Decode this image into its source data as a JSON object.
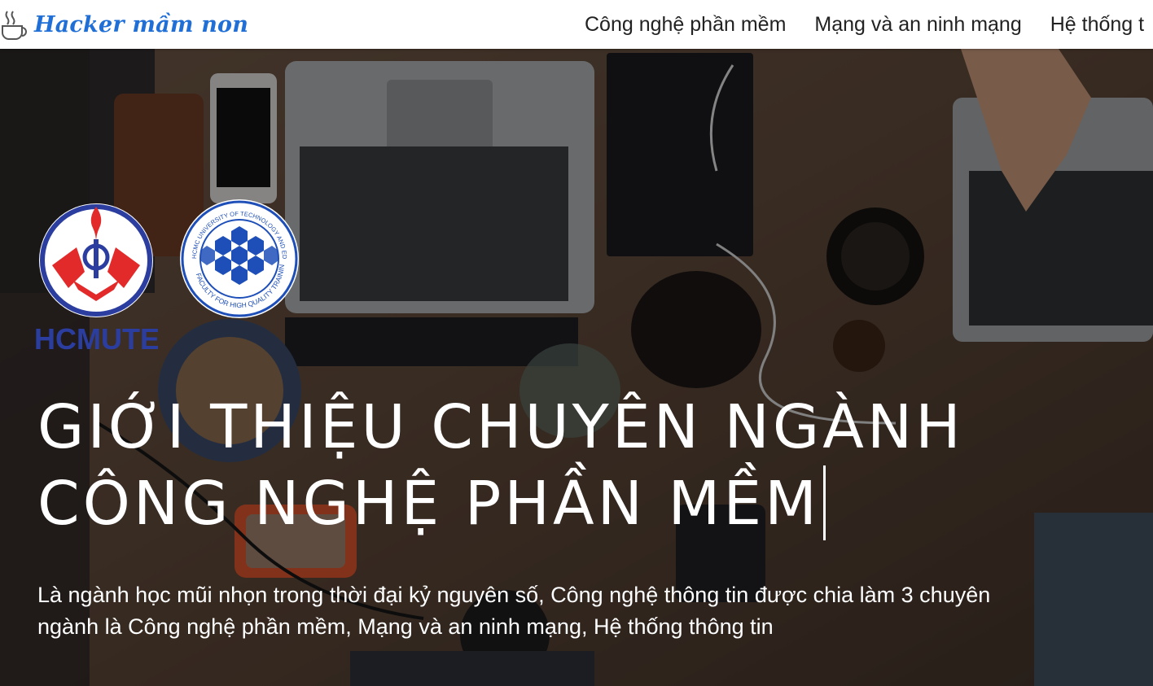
{
  "header": {
    "brand": "Hacker mầm non",
    "brand_icon": "coffee-cup-icon",
    "nav": [
      {
        "label": "Công nghệ phần mềm"
      },
      {
        "label": "Mạng và an ninh mạng"
      },
      {
        "label": "Hệ thống t"
      }
    ]
  },
  "hero": {
    "logos": [
      {
        "name": "hcmute-logo",
        "text": "HCMUTE"
      },
      {
        "name": "faculty-logo",
        "ring_top": "HCMC UNIVERSITY OF TECHNOLOGY AND EDUCATION",
        "ring_bottom": "FACULTY FOR HIGH QUALITY TRAINING"
      }
    ],
    "title_line1": "GIỚI THIỆU CHUYÊN NGÀNH",
    "title_line2": "CÔNG NGHỆ PHẦN MỀM",
    "description": "Là ngành học mũi nhọn trong thời đại kỷ nguyên số, Công nghệ thông tin được chia làm 3 chuyên ngành là Công nghệ phần mềm, Mạng và an ninh mạng, Hệ thống thông tin"
  },
  "colors": {
    "brand": "#1f6fd6",
    "hcmute_red": "#e32a2a",
    "hcmute_blue": "#2b3ea0",
    "faculty_blue": "#1e4fb8"
  }
}
